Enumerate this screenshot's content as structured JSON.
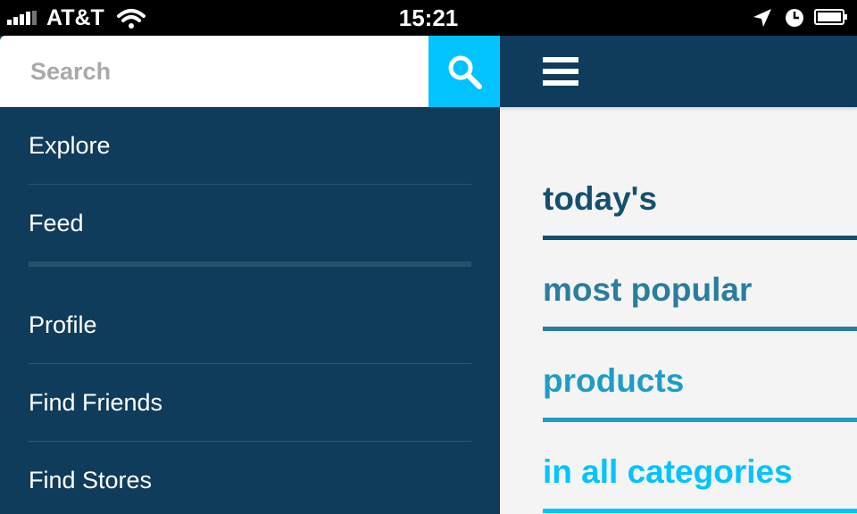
{
  "status_bar": {
    "carrier": "AT&T",
    "time": "15:21",
    "icons": [
      "signal-icon",
      "wifi-icon",
      "location-icon",
      "alarm-icon",
      "battery-icon"
    ]
  },
  "sidebar": {
    "search": {
      "placeholder": "Search",
      "value": ""
    },
    "items": [
      {
        "label": "Explore"
      },
      {
        "label": "Feed"
      },
      {
        "label": "Profile"
      },
      {
        "label": "Find Friends"
      },
      {
        "label": "Find Stores"
      }
    ]
  },
  "main": {
    "headlines": [
      {
        "text": "today's",
        "color": "#15506e"
      },
      {
        "text": "most popular",
        "color": "#2a7d9e"
      },
      {
        "text": "products",
        "color": "#1e9dc6"
      },
      {
        "text": "in all categories",
        "color": "#00c3ff"
      }
    ]
  },
  "colors": {
    "sidebar_bg": "#103c5b",
    "accent": "#00c3ff",
    "main_bg": "#f4f4f4"
  }
}
